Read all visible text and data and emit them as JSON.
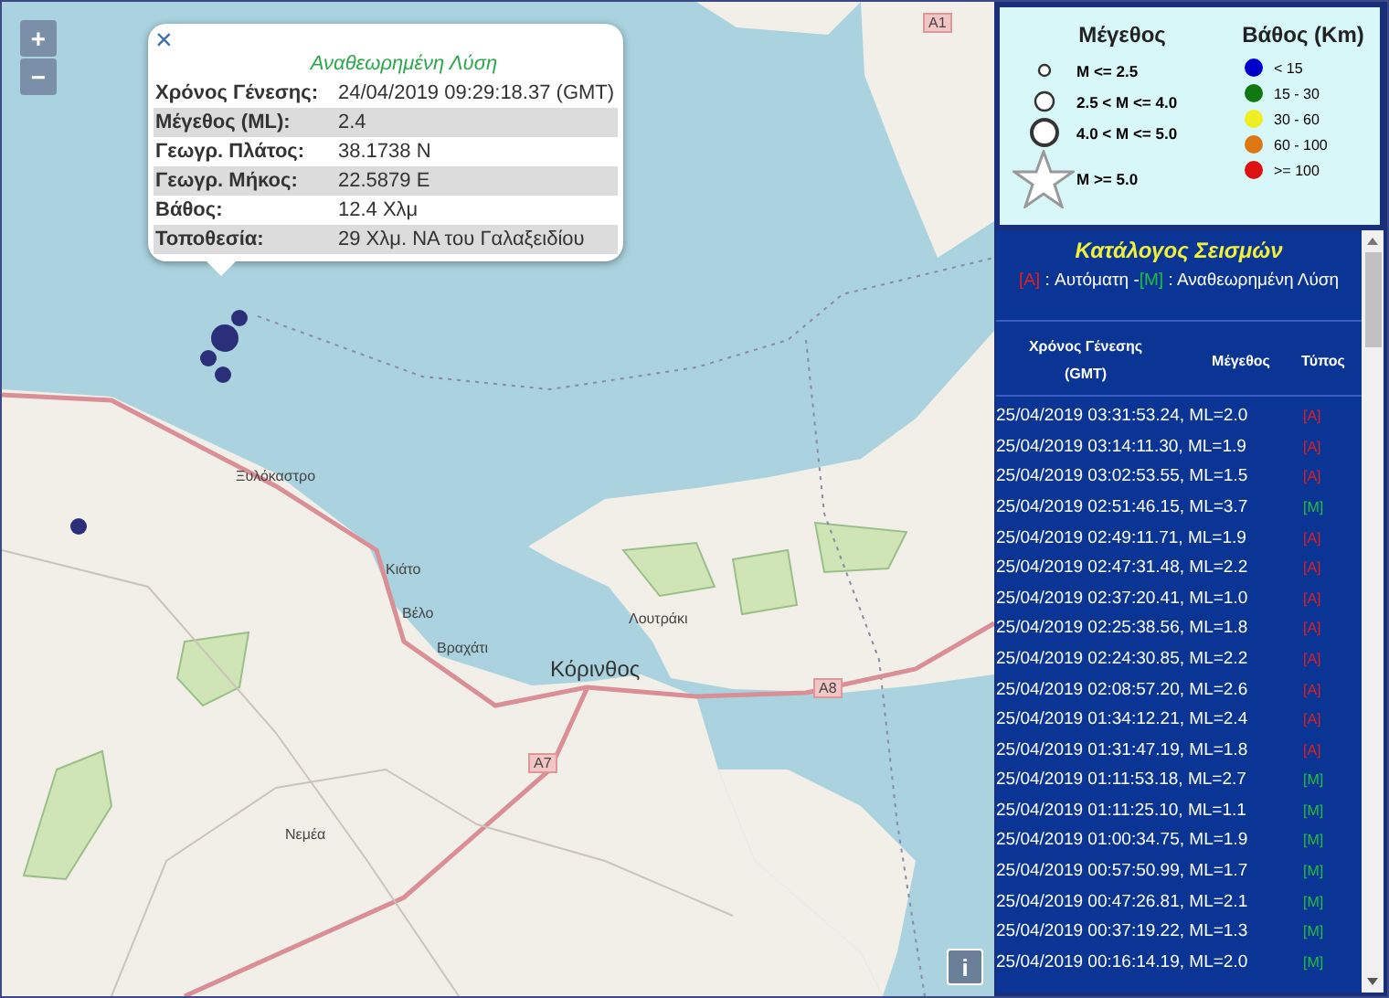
{
  "map": {
    "zoom_in": "+",
    "zoom_out": "−",
    "info": "i",
    "labels": [
      {
        "text": "Ξυλόκαστρο",
        "kind": "place"
      },
      {
        "text": "Κιάτο",
        "kind": "place"
      },
      {
        "text": "Βέλο",
        "kind": "place"
      },
      {
        "text": "Βραχάτι",
        "kind": "place"
      },
      {
        "text": "Λουτράκι",
        "kind": "place"
      },
      {
        "text": "Κόρινθος",
        "kind": "city"
      },
      {
        "text": "Νεμέα",
        "kind": "place"
      },
      {
        "text": "A1",
        "kind": "road"
      },
      {
        "text": "A7",
        "kind": "road"
      },
      {
        "text": "A8",
        "kind": "road"
      }
    ],
    "markers": [
      {
        "kind": "medium"
      },
      {
        "kind": "small"
      },
      {
        "kind": "small"
      },
      {
        "kind": "small"
      },
      {
        "kind": "small"
      }
    ],
    "popup": {
      "close": "×",
      "title": "Αναθεωρημένη Λύση",
      "rows": [
        {
          "label": "Χρόνος Γένεσης:",
          "value": "24/04/2019 09:29:18.37 (GMT)"
        },
        {
          "label": "Μέγεθος (ML):",
          "value": "2.4"
        },
        {
          "label": "Γεωγρ. Πλάτος:",
          "value": "38.1738 N"
        },
        {
          "label": "Γεωγρ. Μήκος:",
          "value": "22.5879 E"
        },
        {
          "label": "Βάθος:",
          "value": "12.4 Χλμ"
        },
        {
          "label": "Τοποθεσία:",
          "value": "29 Χλμ. ΝΑ του Γαλαξειδίου"
        }
      ]
    }
  },
  "legend": {
    "magnitude_title": "Μέγεθος",
    "depth_title": "Βάθος (Km)",
    "magnitudes": [
      {
        "label": "M <= 2.5",
        "kind": "small"
      },
      {
        "label": "2.5 < M <= 4.0",
        "kind": "medium"
      },
      {
        "label": "4.0 < M <= 5.0",
        "kind": "large"
      },
      {
        "label": "M >= 5.0",
        "kind": "star"
      }
    ],
    "depths": [
      {
        "label": "< 15",
        "color": "#0000cc"
      },
      {
        "label": "15 - 30",
        "color": "#117711"
      },
      {
        "label": "30 - 60",
        "color": "#eeee22"
      },
      {
        "label": "60 - 100",
        "color": "#dd7711"
      },
      {
        "label": ">= 100",
        "color": "#dd1111"
      }
    ]
  },
  "catalog": {
    "title": "Κατάλογος Σεισμών",
    "key": [
      {
        "code": "[A]",
        "kind": "auto",
        "text": ": Αυτόματη -"
      },
      {
        "code": "[M]",
        "kind": "revised",
        "text": ": Αναθεωρημένη Λύση"
      }
    ],
    "columns": [
      "Χρόνος Γένεσης (GMT)",
      "Μέγεθος",
      "Τύπος"
    ],
    "rows": [
      {
        "event": "25/04/2019 03:31:53.24, ML=2.0",
        "type": "[A]",
        "kind": "auto"
      },
      {
        "event": "25/04/2019 03:14:11.30, ML=1.9",
        "type": "[A]",
        "kind": "auto"
      },
      {
        "event": "25/04/2019 03:02:53.55, ML=1.5",
        "type": "[A]",
        "kind": "auto"
      },
      {
        "event": "25/04/2019 02:51:46.15, ML=3.7",
        "type": "[M]",
        "kind": "revised"
      },
      {
        "event": "25/04/2019 02:49:11.71, ML=1.9",
        "type": "[A]",
        "kind": "auto"
      },
      {
        "event": "25/04/2019 02:47:31.48, ML=2.2",
        "type": "[A]",
        "kind": "auto"
      },
      {
        "event": "25/04/2019 02:37:20.41, ML=1.0",
        "type": "[A]",
        "kind": "auto"
      },
      {
        "event": "25/04/2019 02:25:38.56, ML=1.8",
        "type": "[A]",
        "kind": "auto"
      },
      {
        "event": "25/04/2019 02:24:30.85, ML=2.2",
        "type": "[A]",
        "kind": "auto"
      },
      {
        "event": "25/04/2019 02:08:57.20, ML=2.6",
        "type": "[A]",
        "kind": "auto"
      },
      {
        "event": "25/04/2019 01:34:12.21, ML=2.4",
        "type": "[A]",
        "kind": "auto"
      },
      {
        "event": "25/04/2019 01:31:47.19, ML=1.8",
        "type": "[A]",
        "kind": "auto"
      },
      {
        "event": "25/04/2019 01:11:53.18, ML=2.7",
        "type": "[M]",
        "kind": "revised"
      },
      {
        "event": "25/04/2019 01:11:25.10, ML=1.1",
        "type": "[M]",
        "kind": "revised"
      },
      {
        "event": "25/04/2019 01:00:34.75, ML=1.9",
        "type": "[M]",
        "kind": "revised"
      },
      {
        "event": "25/04/2019 00:57:50.99, ML=1.7",
        "type": "[M]",
        "kind": "revised"
      },
      {
        "event": "25/04/2019 00:47:26.81, ML=2.1",
        "type": "[M]",
        "kind": "revised"
      },
      {
        "event": "25/04/2019 00:37:19.22, ML=1.3",
        "type": "[M]",
        "kind": "revised"
      },
      {
        "event": "25/04/2019 00:16:14.19, ML=2.0",
        "type": "[M]",
        "kind": "revised"
      }
    ]
  }
}
